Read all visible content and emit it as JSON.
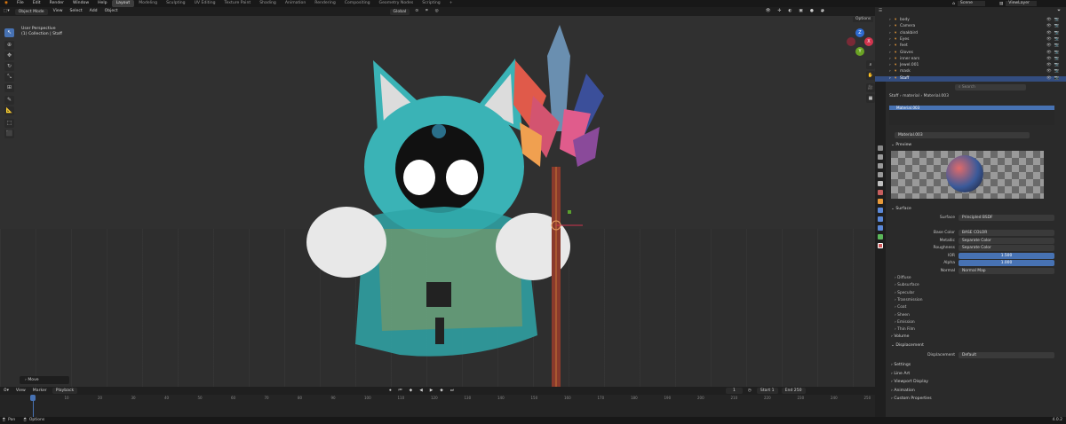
{
  "menu": {
    "items": [
      "File",
      "Edit",
      "Render",
      "Window",
      "Help"
    ]
  },
  "workspaces": [
    "Layout",
    "Modeling",
    "Sculpting",
    "UV Editing",
    "Texture Paint",
    "Shading",
    "Animation",
    "Rendering",
    "Compositing",
    "Geometry Nodes",
    "Scripting"
  ],
  "active_workspace": "Layout",
  "scene_name": "Scene",
  "view_layer": "ViewLayer",
  "viewport": {
    "mode": "Object Mode",
    "menus": [
      "View",
      "Select",
      "Add",
      "Object"
    ],
    "transform": "Global",
    "info1": "User Perspective",
    "info2": "(1) Collection | Staff",
    "options": "Options",
    "last_op": "Move"
  },
  "timeline": {
    "menus": [
      "View",
      "Marker",
      "Playback"
    ],
    "frame": "1",
    "start_label": "Start",
    "start": "1",
    "end_label": "End",
    "end": "250",
    "ticks": [
      "1",
      "10",
      "20",
      "30",
      "40",
      "50",
      "60",
      "70",
      "80",
      "90",
      "100",
      "110",
      "120",
      "130",
      "140",
      "150",
      "160",
      "170",
      "180",
      "190",
      "200",
      "210",
      "220",
      "230",
      "240",
      "250"
    ]
  },
  "status": {
    "left": "Pan",
    "mid": "Options",
    "version": "4.0.2"
  },
  "outliner": {
    "rows": [
      {
        "name": "body"
      },
      {
        "name": "Camera"
      },
      {
        "name": "cloakbird"
      },
      {
        "name": "Eyes"
      },
      {
        "name": "feet"
      },
      {
        "name": "Gloves"
      },
      {
        "name": "inner ears"
      },
      {
        "name": "Jewel.001"
      },
      {
        "name": "mask"
      },
      {
        "name": "Staff",
        "selected": true
      }
    ]
  },
  "properties": {
    "search_placeholder": "Search",
    "breadcrumb": [
      "Staff",
      "material",
      "Material.003"
    ],
    "slot": "Material.003",
    "material_name": "Material.003",
    "preview_label": "Preview",
    "surface_label": "Surface",
    "surface_field": "Surface",
    "surface_value": "Principled BSDF",
    "fields": [
      {
        "label": "Base Color",
        "value": "BASE COLOR"
      },
      {
        "label": "Metallic",
        "value": "Separate Color"
      },
      {
        "label": "Roughness",
        "value": "Separate Color"
      },
      {
        "label": "IOR",
        "value": "1.500"
      },
      {
        "label": "Alpha",
        "value": "1.000"
      },
      {
        "label": "Normal",
        "value": "Normal Map"
      }
    ],
    "subpanels": [
      "Diffuse",
      "Subsurface",
      "Specular",
      "Transmission",
      "Coat",
      "Sheen",
      "Emission",
      "Thin Film"
    ],
    "volume": "Volume",
    "displacement": "Displacement",
    "displacement_field": "Displacement",
    "displacement_value": "Default",
    "bottom": [
      "Settings",
      "Line Art",
      "Viewport Display",
      "Animation",
      "Custom Properties"
    ]
  }
}
